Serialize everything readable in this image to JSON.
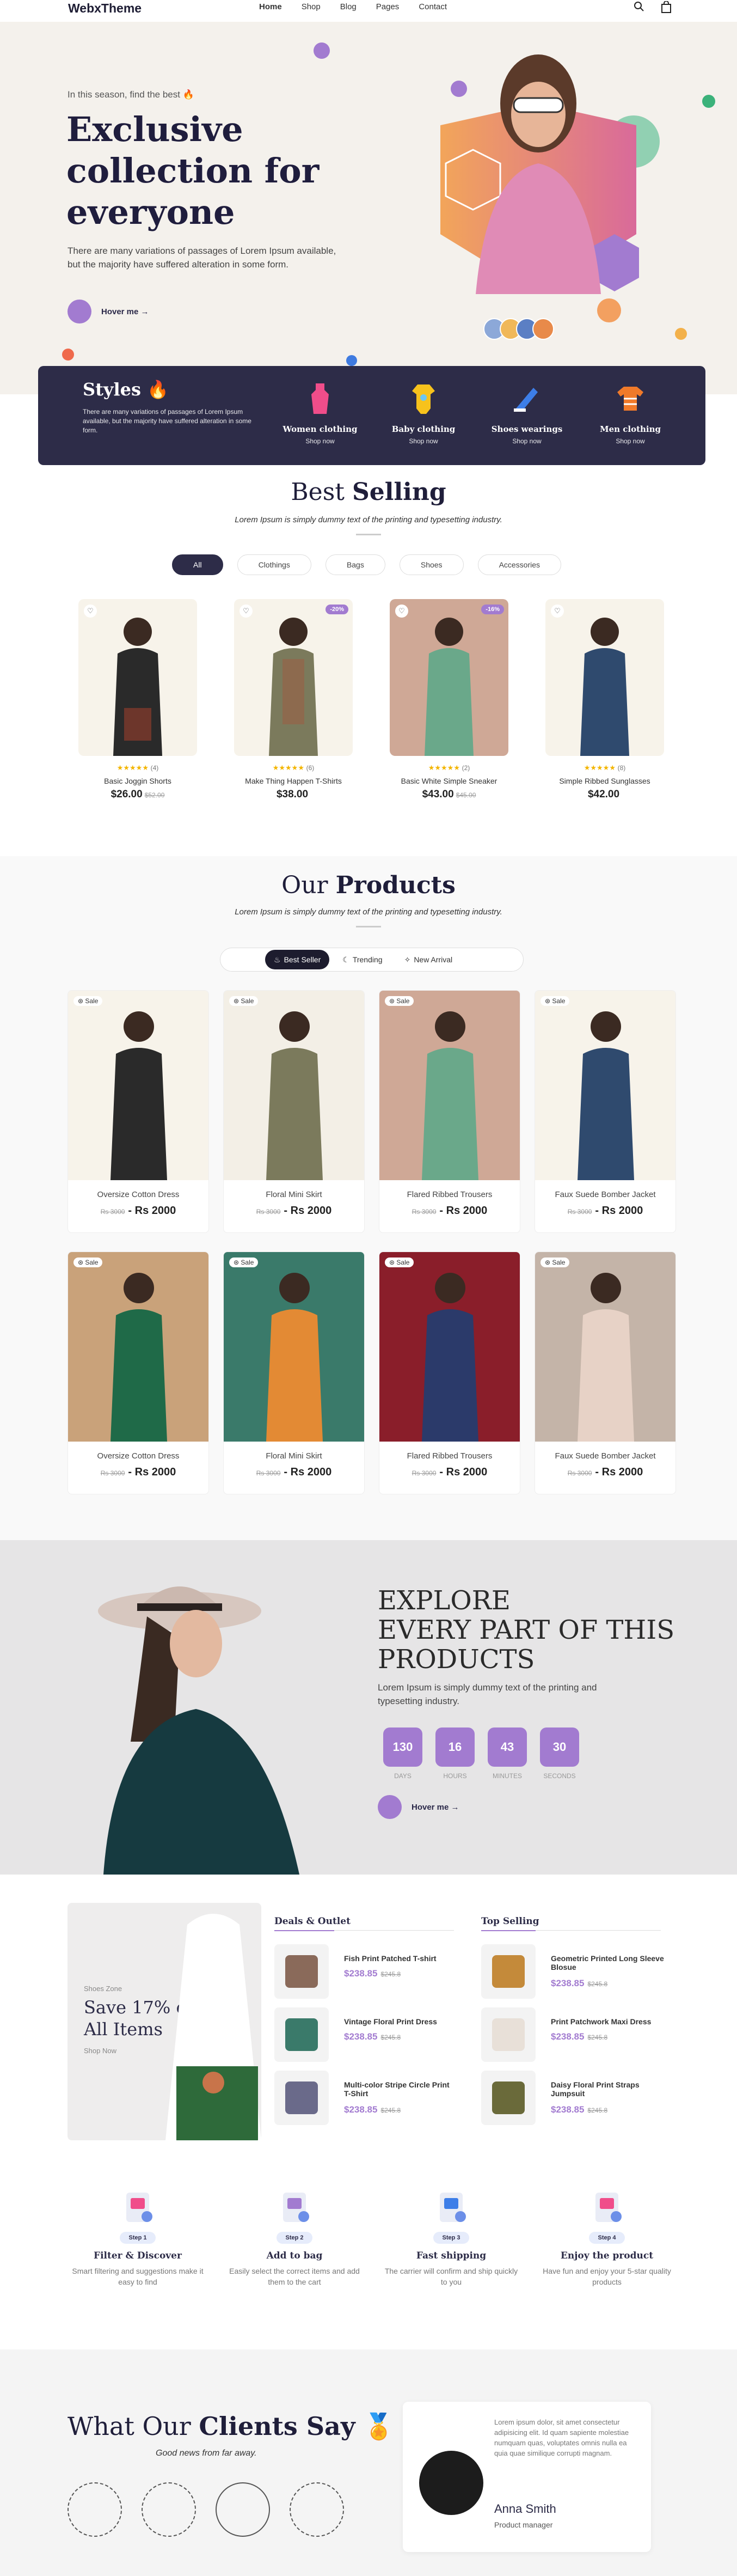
{
  "header": {
    "logo": "WebxTheme",
    "nav": [
      "Home",
      "Shop",
      "Blog",
      "Pages",
      "Contact"
    ]
  },
  "hero": {
    "kicker": "In this season, find the best 🔥",
    "title_line1": "Exclusive",
    "title_line2": "collection for",
    "title_line3": "everyone",
    "desc": "There are many variations of passages of Lorem Ipsum available, but the majority have suffered alteration in some form.",
    "cta": "Hover me →"
  },
  "styles_banner": {
    "title": "Styles 🔥",
    "desc": "There are many variations of passages of Lorem Ipsum available, but the majority have suffered alteration in some form.",
    "categories": [
      {
        "label": "Women clothing",
        "link": "Shop now"
      },
      {
        "label": "Baby clothing",
        "link": "Shop now"
      },
      {
        "label": "Shoes wearings",
        "link": "Shop now"
      },
      {
        "label": "Men clothing",
        "link": "Shop now"
      }
    ]
  },
  "best_selling": {
    "title_a": "Best",
    "title_b": "Selling",
    "subtitle": "Lorem Ipsum is simply dummy text of the printing and typesetting industry.",
    "tabs": [
      "All",
      "Clothings",
      "Bags",
      "Shoes",
      "Accessories"
    ],
    "products": [
      {
        "name": "Basic Joggin Shorts",
        "rating": "★★★★★",
        "reviews": "(4)",
        "price": "$26.00",
        "old": "$52.00",
        "badge": ""
      },
      {
        "name": "Make Thing Happen T-Shirts",
        "rating": "★★★★★",
        "reviews": "(6)",
        "price": "$38.00",
        "old": "",
        "badge": "-20%"
      },
      {
        "name": "Basic White Simple Sneaker",
        "rating": "★★★★★",
        "reviews": "(2)",
        "price": "$43.00",
        "old": "$45.00",
        "badge": "-16%"
      },
      {
        "name": "Simple Ribbed Sunglasses",
        "rating": "★★★★★",
        "reviews": "(8)",
        "price": "$42.00",
        "old": "",
        "badge": ""
      }
    ]
  },
  "our_products": {
    "title_a": "Our",
    "title_b": "Products",
    "subtitle": "Lorem Ipsum is simply dummy text of the printing and typesetting industry.",
    "tabs": [
      "Best Seller",
      "Trending",
      "New Arrival"
    ],
    "sale_label": "Sale",
    "items": [
      {
        "name": "Oversize Cotton Dress",
        "old": "Rs 3000",
        "price": "- Rs 2000"
      },
      {
        "name": "Floral Mini Skirt",
        "old": "Rs 3000",
        "price": "- Rs 2000"
      },
      {
        "name": "Flared Ribbed Trousers",
        "old": "Rs 3000",
        "price": "- Rs 2000"
      },
      {
        "name": "Faux Suede Bomber Jacket",
        "old": "Rs 3000",
        "price": "- Rs 2000"
      },
      {
        "name": "Oversize Cotton Dress",
        "old": "Rs 3000",
        "price": "- Rs 2000"
      },
      {
        "name": "Floral Mini Skirt",
        "old": "Rs 3000",
        "price": "- Rs 2000"
      },
      {
        "name": "Flared Ribbed Trousers",
        "old": "Rs 3000",
        "price": "- Rs 2000"
      },
      {
        "name": "Faux Suede Bomber Jacket",
        "old": "Rs 3000",
        "price": "- Rs 2000"
      }
    ]
  },
  "explore": {
    "line1": "EXPLORE",
    "line2": "EVERY PART OF THIS",
    "line3": "PRODUCTS",
    "desc": "Lorem Ipsum is simply dummy text of the printing and typesetting industry.",
    "timer": [
      {
        "n": "130",
        "l": "DAYS"
      },
      {
        "n": "16",
        "l": "HOURS"
      },
      {
        "n": "43",
        "l": "MINUTES"
      },
      {
        "n": "30",
        "l": "SECONDS"
      }
    ],
    "cta": "Hover me →"
  },
  "deals": {
    "promo_kicker": "Shoes Zone",
    "promo_title1": "Save 17% on",
    "promo_title2": "All Items",
    "promo_link": "Shop Now",
    "col1_title": "Deals & Outlet",
    "col2_title": "Top Selling",
    "col1": [
      {
        "name": "Fish Print Patched T-shirt",
        "price": "$238.85",
        "old": "$245.8"
      },
      {
        "name": "Vintage Floral Print Dress",
        "price": "$238.85",
        "old": "$245.8"
      },
      {
        "name": "Multi-color Stripe Circle Print T-Shirt",
        "price": "$238.85",
        "old": "$245.8"
      }
    ],
    "col2": [
      {
        "name": "Geometric Printed Long Sleeve Blosue",
        "price": "$238.85",
        "old": "$245.8"
      },
      {
        "name": "Print Patchwork Maxi Dress",
        "price": "$238.85",
        "old": "$245.8"
      },
      {
        "name": "Daisy Floral Print Straps Jumpsuit",
        "price": "$238.85",
        "old": "$245.8"
      }
    ]
  },
  "steps": [
    {
      "pill": "Step 1",
      "title": "Filter & Discover",
      "desc": "Smart filtering and suggestions make it easy to find"
    },
    {
      "pill": "Step 2",
      "title": "Add to bag",
      "desc": "Easily select the correct items and add them to the cart"
    },
    {
      "pill": "Step 3",
      "title": "Fast shipping",
      "desc": "The carrier will confirm and ship quickly to you"
    },
    {
      "pill": "Step 4",
      "title": "Enjoy the product",
      "desc": "Have fun and enjoy your 5-star quality products"
    }
  ],
  "testimonials": {
    "title_a": "What Our",
    "title_b": "Clients Say",
    "subtitle": "Good news from far away.",
    "quote": "Lorem ipsum dolor, sit amet consectetur adipisicing elit. Id quam sapiente molestiae numquam quas, voluptates omnis nulla ea quia quae similique corrupti magnam.",
    "name": "Anna Smith",
    "role": "Product manager"
  },
  "colors": {
    "accent": "#a27bd0",
    "dark": "#2d2c48",
    "hero_bg": "#f4f1ec"
  }
}
